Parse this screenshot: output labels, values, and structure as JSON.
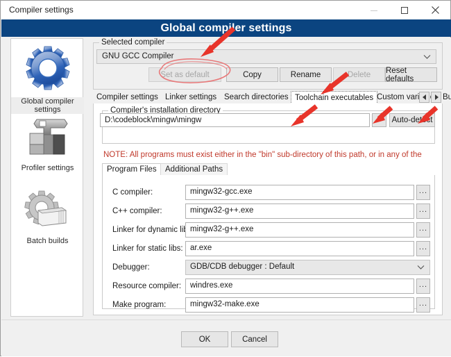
{
  "window": {
    "caption": "Compiler settings",
    "header_title": "Global compiler settings",
    "controls": {
      "minimize": "minimize-icon",
      "maximize": "maximize-icon",
      "close": "close-icon"
    },
    "accent_color": "#0b4480",
    "note_color": "#c0392b",
    "annotation_color": "#e8342a"
  },
  "sidebar": {
    "items": [
      {
        "label": "Global compiler\nsettings",
        "label_line1": "Global compiler",
        "label_line2": "settings",
        "icon": "blue-gear-icon",
        "selected": true
      },
      {
        "label": "Profiler settings",
        "label_line1": "Profiler settings",
        "label_line2": "",
        "icon": "caliper-icon",
        "selected": false
      },
      {
        "label": "Batch builds",
        "label_line1": "Batch builds",
        "label_line2": "",
        "icon": "gear-pages-icon",
        "selected": false
      }
    ]
  },
  "selected_compiler": {
    "group_label": "Selected compiler",
    "combo_value": "GNU GCC Compiler",
    "combo_caret": "chevron-down-icon",
    "buttons": [
      {
        "label": "Set as default",
        "disabled": true
      },
      {
        "label": "Copy",
        "disabled": false
      },
      {
        "label": "Rename",
        "disabled": false
      },
      {
        "label": "Delete",
        "disabled": true
      },
      {
        "label": "Reset defaults",
        "disabled": false
      }
    ]
  },
  "tabs": {
    "items": [
      {
        "label": "Compiler settings",
        "active": false
      },
      {
        "label": "Linker settings",
        "active": false
      },
      {
        "label": "Search directories",
        "active": false
      },
      {
        "label": "Toolchain executables",
        "active": true
      },
      {
        "label": "Custom variables",
        "active": false
      },
      {
        "label": "Bui",
        "active": false
      }
    ],
    "scroll_left": "◄",
    "scroll_right": "►"
  },
  "install_dir": {
    "group_label": "Compiler's installation directory",
    "value": "D:\\codeblock\\mingw\\mingw",
    "browse_label": "...",
    "autodetect_label": "Auto-detect",
    "note": "NOTE: All programs must exist either in the \"bin\" sub-directory of this path, or in any of the"
  },
  "inner_tabs": {
    "items": [
      {
        "label": "Program Files",
        "active": true
      },
      {
        "label": "Additional Paths",
        "active": false
      }
    ]
  },
  "program_files": {
    "rows": [
      {
        "label": "C compiler:",
        "value": "mingw32-gcc.exe",
        "type": "text",
        "dots": "..."
      },
      {
        "label": "C++ compiler:",
        "value": "mingw32-g++.exe",
        "type": "text",
        "dots": "..."
      },
      {
        "label": "Linker for dynamic libs:",
        "value": "mingw32-g++.exe",
        "type": "text",
        "dots": "..."
      },
      {
        "label": "Linker for static libs:",
        "value": "ar.exe",
        "type": "text",
        "dots": "..."
      },
      {
        "label": "Debugger:",
        "value": "GDB/CDB debugger : Default",
        "type": "combo",
        "dots": ""
      },
      {
        "label": "Resource compiler:",
        "value": "windres.exe",
        "type": "text",
        "dots": "..."
      },
      {
        "label": "Make program:",
        "value": "mingw32-make.exe",
        "type": "text",
        "dots": "..."
      }
    ]
  },
  "footer": {
    "ok_label": "OK",
    "cancel_label": "Cancel"
  }
}
